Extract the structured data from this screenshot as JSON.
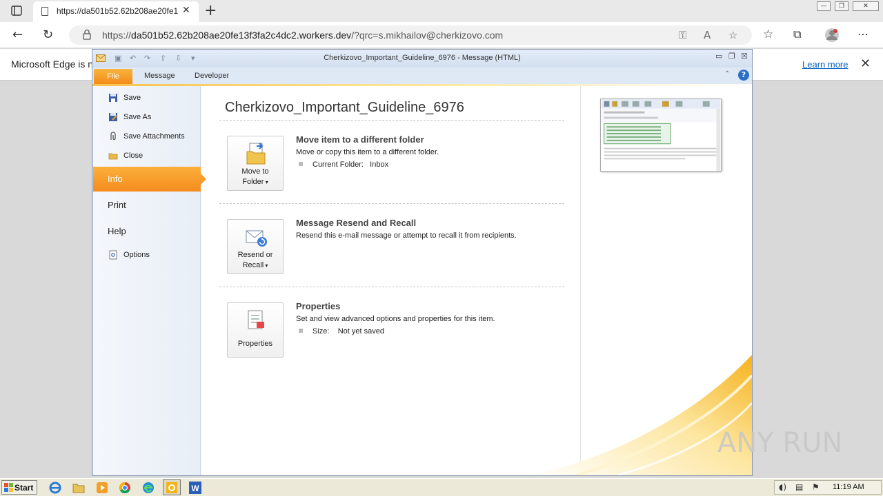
{
  "browser": {
    "tab_title": "https://da501b52.62b208ae20fe1…",
    "url_prefix": "https://",
    "url_host": "da501b52.62b208ae20fe13f3fa2c4dc2.workers.dev",
    "url_path": "/?qrc=s.mikhailov@cherkizovo.com"
  },
  "infobar": {
    "text": "Microsoft Edge is n",
    "learn_more": "Learn more"
  },
  "outlook": {
    "window_title": "Cherkizovo_Important_Guideline_6976  -  Message (HTML)",
    "ribbon_tabs": {
      "file": "File",
      "message": "Message",
      "developer": "Developer"
    },
    "nav": {
      "save": "Save",
      "save_as": "Save As",
      "save_attachments": "Save Attachments",
      "close": "Close",
      "info": "Info",
      "print": "Print",
      "help": "Help",
      "options": "Options"
    },
    "doc_title": "Cherkizovo_Important_Guideline_6976",
    "sections": {
      "move": {
        "button_line1": "Move to",
        "button_line2": "Folder",
        "title": "Move item to a different folder",
        "desc": "Move or copy this item to a different folder.",
        "prop_label": "Current Folder:",
        "prop_value": "Inbox"
      },
      "resend": {
        "button_line1": "Resend or",
        "button_line2": "Recall",
        "title": "Message Resend and Recall",
        "desc": "Resend this e-mail message or attempt to recall it from recipients."
      },
      "properties": {
        "button_label": "Properties",
        "title": "Properties",
        "desc": "Set and view advanced options and properties for this item.",
        "prop_label": "Size:",
        "prop_value": "Not yet saved"
      }
    }
  },
  "taskbar": {
    "start": "Start",
    "clock": "11:19 AM"
  },
  "watermark": "ANY RUN",
  "colors": {
    "accent_orange": "#f58c1f",
    "link_blue": "#0563c1",
    "taskbar_bg": "#ece9d8"
  }
}
